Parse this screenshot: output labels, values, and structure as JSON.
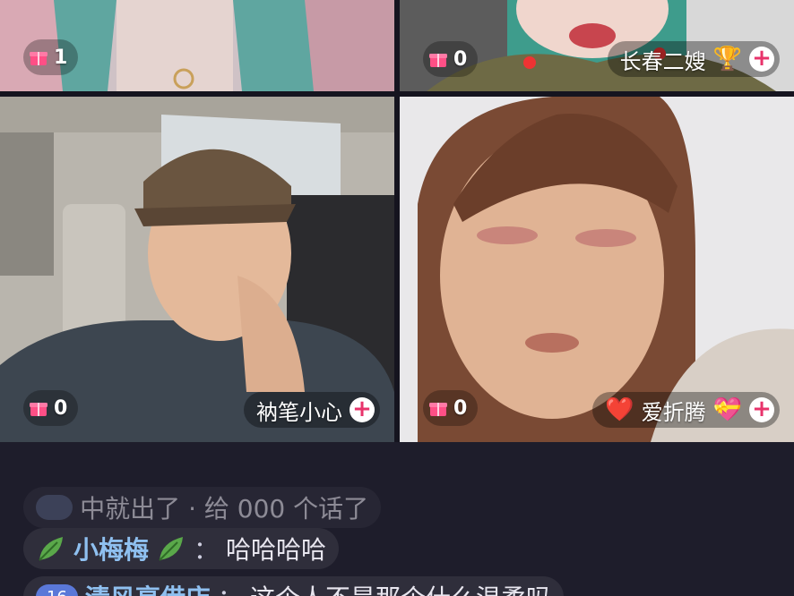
{
  "colors": {
    "background": "#1e1d2b",
    "sender": "#8fc0f0",
    "follow_plus": "#e8336b",
    "gift": "#ff4f86"
  },
  "tiles": [
    {
      "gift_count": "1",
      "name": "",
      "name_emoji": "",
      "show_name": false
    },
    {
      "gift_count": "0",
      "name": "长春二嫂",
      "name_emoji_icon": "trophy-icon",
      "name_emoji": "🏆",
      "show_name": true
    },
    {
      "gift_count": "0",
      "name": "衲笔小心",
      "name_emoji": "",
      "show_name": true
    },
    {
      "gift_count": "0",
      "name": "爱折腾",
      "name_prefix_icon": "heart-icon",
      "name_prefix": "❤️",
      "name_emoji_icon": "gift-heart-icon",
      "name_emoji": "💝",
      "show_name": true
    }
  ],
  "follow_symbol": "+",
  "chat": {
    "messages": [
      {
        "badge": "",
        "sender": "",
        "text": "中就出了 · 给 000 个话了"
      },
      {
        "badge": "",
        "sender": "小梅梅",
        "sender_icon": "leaf-icon",
        "colon": "：",
        "text": "哈哈哈哈"
      },
      {
        "badge": "16",
        "sender": "清风亮借店",
        "colon": "：",
        "text": "这个人不是那个什么温柔吗"
      }
    ]
  }
}
